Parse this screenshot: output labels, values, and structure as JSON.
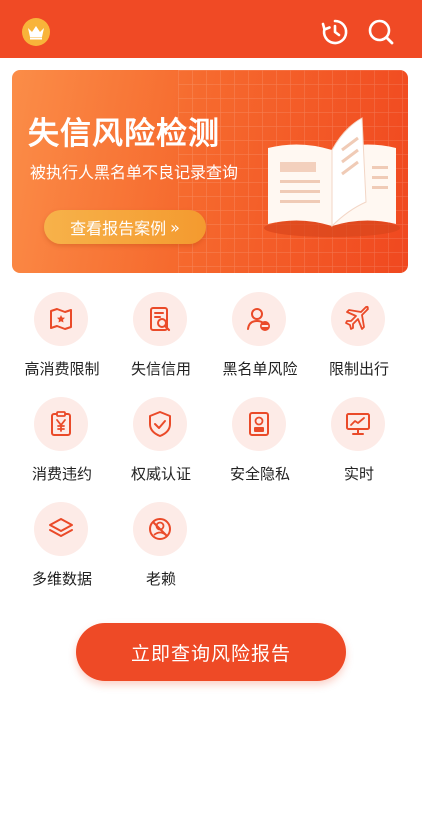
{
  "header": {
    "crown_icon": "crown-icon",
    "history_icon": "history-icon",
    "search_icon": "search-icon",
    "background": "#f04a25"
  },
  "banner": {
    "title": "失信风险检测",
    "subtitle": "被执行人黑名单不良记录查询",
    "case_button": "查看报告案例",
    "case_button_arrow": "»"
  },
  "services": [
    {
      "label": "高消费限制",
      "icon": "map-flag-icon"
    },
    {
      "label": "失信信用",
      "icon": "document-search-icon"
    },
    {
      "label": "黑名单风险",
      "icon": "user-minus-icon"
    },
    {
      "label": "限制出行",
      "icon": "airplane-icon"
    },
    {
      "label": "消费违约",
      "icon": "yuan-clipboard-icon"
    },
    {
      "label": "权威认证",
      "icon": "shield-check-icon"
    },
    {
      "label": "安全隐私",
      "icon": "id-badge-icon"
    },
    {
      "label": "实时",
      "icon": "monitor-chart-icon"
    },
    {
      "label": "多维数据",
      "icon": "layers-icon"
    },
    {
      "label": "老赖",
      "icon": "banned-user-icon"
    }
  ],
  "cta": {
    "label": "立即查询风险报告"
  },
  "colors": {
    "accent": "#f04a25",
    "icon_bg": "#fdebe7",
    "gold": "#f8b43a"
  }
}
